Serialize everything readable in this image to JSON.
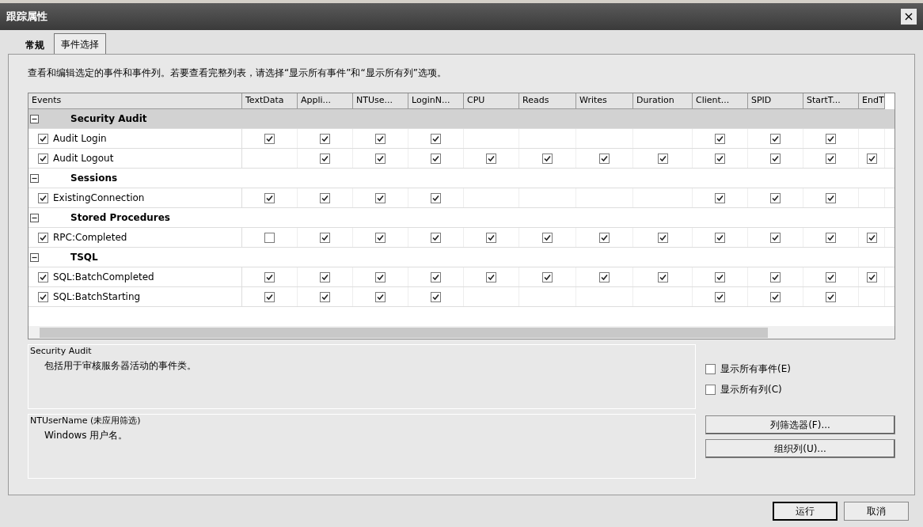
{
  "window": {
    "title": "跟踪属性",
    "close": "×"
  },
  "tabs": [
    {
      "label": "常规",
      "selected": false
    },
    {
      "label": "事件选择",
      "selected": true
    }
  ],
  "instruction": "查看和编辑选定的事件和事件列。若要查看完整列表，请选择“显示所有事件”和“显示所有列”选项。",
  "grid": {
    "columns": [
      "Events",
      "TextData",
      "Appli...",
      "NTUse...",
      "LoginN...",
      "CPU",
      "Reads",
      "Writes",
      "Duration",
      "Client...",
      "SPID",
      "StartT...",
      "EndT"
    ],
    "categories": [
      {
        "name": "Security Audit",
        "selected": true,
        "expanded": true,
        "events": [
          {
            "name": "Audit Login",
            "checked": true,
            "cells": [
              true,
              true,
              true,
              true,
              null,
              null,
              null,
              null,
              true,
              true,
              true,
              null
            ]
          },
          {
            "name": "Audit Logout",
            "checked": true,
            "cells": [
              null,
              true,
              true,
              true,
              true,
              true,
              true,
              true,
              true,
              true,
              true,
              true
            ]
          }
        ]
      },
      {
        "name": "Sessions",
        "selected": false,
        "expanded": true,
        "events": [
          {
            "name": "ExistingConnection",
            "checked": true,
            "cells": [
              true,
              true,
              true,
              true,
              null,
              null,
              null,
              null,
              true,
              true,
              true,
              null
            ]
          }
        ]
      },
      {
        "name": "Stored Procedures",
        "selected": false,
        "expanded": true,
        "events": [
          {
            "name": "RPC:Completed",
            "checked": true,
            "cells": [
              false,
              true,
              true,
              true,
              true,
              true,
              true,
              true,
              true,
              true,
              true,
              true
            ]
          }
        ]
      },
      {
        "name": "TSQL",
        "selected": false,
        "expanded": true,
        "events": [
          {
            "name": "SQL:BatchCompleted",
            "checked": true,
            "cells": [
              true,
              true,
              true,
              true,
              true,
              true,
              true,
              true,
              true,
              true,
              true,
              true
            ]
          },
          {
            "name": "SQL:BatchStarting",
            "checked": true,
            "cells": [
              true,
              true,
              true,
              true,
              null,
              null,
              null,
              null,
              true,
              true,
              true,
              null
            ]
          }
        ]
      }
    ]
  },
  "description": {
    "title": "Security Audit",
    "text": "包括用于审核服务器活动的事件类。"
  },
  "column_info": {
    "title": "NTUserName (未应用筛选)",
    "text": "Windows 用户名。"
  },
  "options": [
    {
      "label": "显示所有事件(E)",
      "checked": false
    },
    {
      "label": "显示所有列(C)",
      "checked": false
    }
  ],
  "side_buttons": [
    "列筛选器(F)...",
    "组织列(U)..."
  ],
  "footer_buttons": [
    {
      "label": "运行",
      "default": true
    },
    {
      "label": "取消",
      "default": false
    }
  ]
}
